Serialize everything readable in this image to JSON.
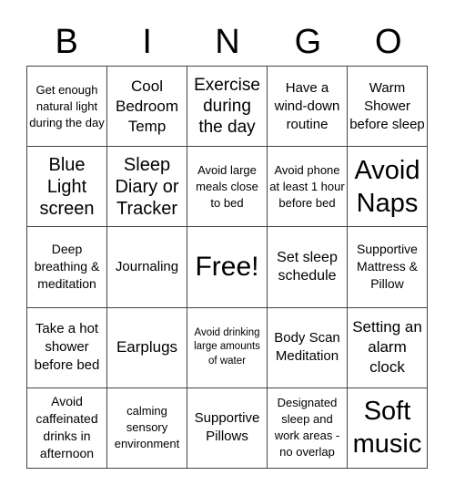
{
  "header": {
    "letters": [
      "B",
      "I",
      "N",
      "G",
      "O"
    ]
  },
  "cells": [
    "Get enough natural light during the day",
    "Cool Bedroom Temp",
    "Exercise during the day",
    "Have a wind-down routine",
    "Warm Shower before sleep",
    "Blue Light screen",
    "Sleep Diary or Tracker",
    "Avoid large meals close to bed",
    "Avoid phone at least 1 hour before bed",
    "Avoid Naps",
    "Deep breathing & meditation",
    "Journaling",
    "Free!",
    "Set sleep schedule",
    "Supportive Mattress & Pillow",
    "Take a hot shower before bed",
    "Earplugs",
    "Avoid drinking large amounts of water",
    "Body Scan Meditation",
    "Setting an alarm clock",
    "Avoid caffeinated drinks in afternoon",
    "calming sensory environment",
    "Supportive Pillows",
    "Designated sleep and work areas - no overlap",
    "Soft music"
  ]
}
